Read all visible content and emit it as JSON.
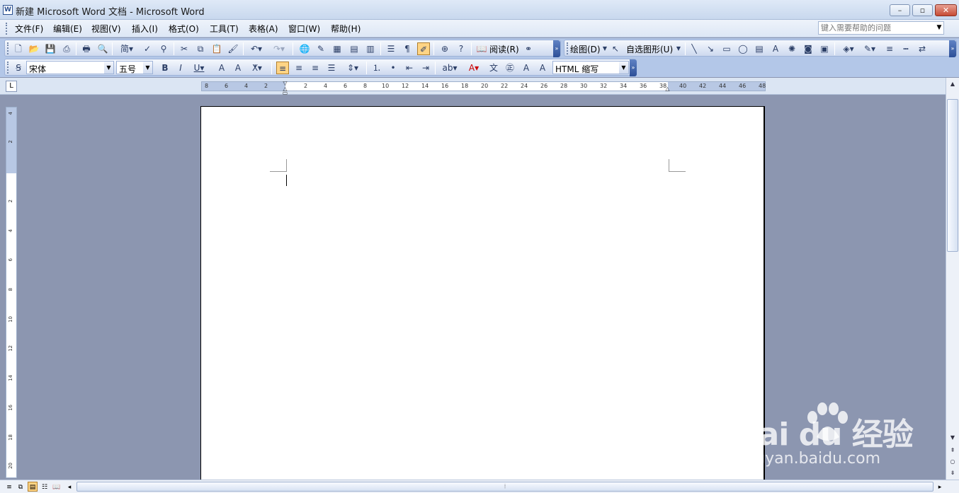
{
  "window": {
    "title": "新建 Microsoft Word 文档 - Microsoft Word",
    "app_icon": "word-icon"
  },
  "menu": {
    "items": [
      "文件(F)",
      "编辑(E)",
      "视图(V)",
      "插入(I)",
      "格式(O)",
      "工具(T)",
      "表格(A)",
      "窗口(W)",
      "帮助(H)"
    ],
    "help_placeholder": "键入需要帮助的问题"
  },
  "standard_toolbar": {
    "read_label": "阅读(R)",
    "draw_label": "绘图(D)",
    "autoshapes_label": "自选图形(U)"
  },
  "format_toolbar": {
    "style_value": "宋体",
    "size_value": "五号",
    "style_box_value": "HTML 缩写"
  },
  "ruler": {
    "h_ticks": [
      "8",
      "6",
      "4",
      "2",
      "2",
      "4",
      "6",
      "8",
      "10",
      "12",
      "14",
      "16",
      "18",
      "20",
      "22",
      "24",
      "26",
      "28",
      "30",
      "32",
      "34",
      "36",
      "38",
      "40",
      "42",
      "44",
      "46",
      "48"
    ],
    "v_ticks": [
      "4",
      "2",
      "2",
      "4",
      "6",
      "8",
      "10",
      "12",
      "14",
      "16",
      "18",
      "20"
    ],
    "tab_selector": "L"
  },
  "watermark": {
    "main": "Bai du 经验",
    "sub": "jingyan.baidu.com"
  },
  "colors": {
    "accent_active": "#ffd484",
    "toolbar_bg": "#b3c7e8",
    "workspace_bg": "#8c96b0"
  }
}
